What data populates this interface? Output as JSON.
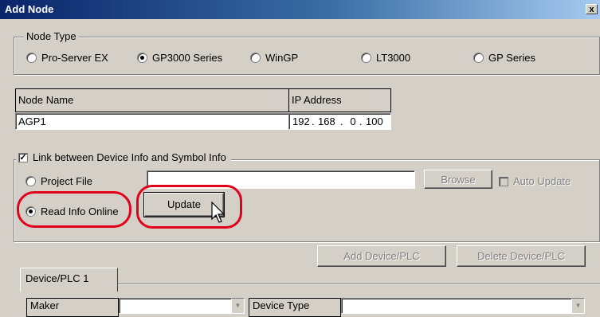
{
  "window": {
    "title": "Add Node",
    "close_label": "x"
  },
  "node_type": {
    "legend": "Node Type",
    "options": [
      {
        "label": "Pro-Server EX",
        "checked": false
      },
      {
        "label": "GP3000 Series",
        "checked": true
      },
      {
        "label": "WinGP",
        "checked": false
      },
      {
        "label": "LT3000",
        "checked": false
      },
      {
        "label": "GP Series",
        "checked": false
      }
    ]
  },
  "node_table": {
    "name_header": "Node Name",
    "ip_header": "IP Address",
    "name_value": "AGP1",
    "ip_octets": [
      "192",
      "168",
      "0",
      "100"
    ]
  },
  "link": {
    "checkbox_label": "Link between Device Info and Symbol Info",
    "checked": true,
    "project_file_label": "Project File",
    "browse_label": "Browse",
    "auto_update_label": "Auto Update",
    "read_online_label": "Read Info Online",
    "update_label": "Update"
  },
  "devices": {
    "add_label": "Add Device/PLC",
    "delete_label": "Delete Device/PLC",
    "tab_label": "Device/PLC 1",
    "maker_label": "Maker",
    "device_type_label": "Device Type"
  },
  "colors": {
    "highlight": "#e3001b",
    "titlebar": "#0a246a"
  }
}
